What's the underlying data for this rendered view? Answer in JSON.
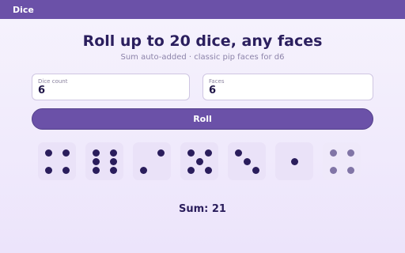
{
  "app": {
    "title": "Dice"
  },
  "heading": {
    "title": "Roll up to 20 dice, any faces",
    "subtitle": "Sum auto-added · classic pip faces for d6"
  },
  "form": {
    "count_label": "Dice count",
    "count_value": "6",
    "faces_label": "Faces",
    "faces_value": "6"
  },
  "roll_button": {
    "label": "Roll"
  },
  "dice": [
    4,
    6,
    2,
    5,
    3,
    1
  ],
  "result": {
    "sum_text": "Sum: 21"
  },
  "colors": {
    "accent": "#6b51a8",
    "text": "#2a1d5c",
    "die_bg": "#eae2f8"
  }
}
